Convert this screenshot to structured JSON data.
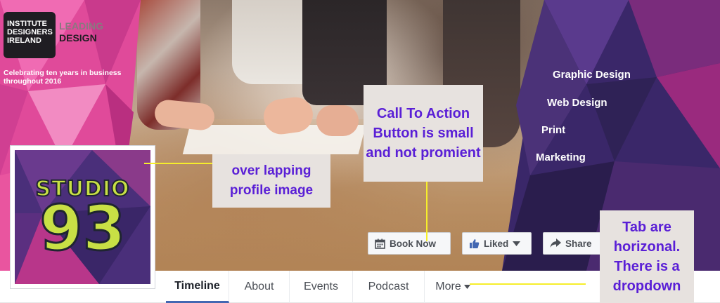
{
  "cover": {
    "logo_lines": [
      "INSTITUTE",
      "DESIGNERS",
      "IRELAND"
    ],
    "leading_lines": [
      "LEADING",
      "DESIGN"
    ],
    "celebration": "Celebrating ten years in business throughout 2016",
    "services": [
      "Graphic Design",
      "Web Design",
      "Print",
      "Marketing"
    ]
  },
  "profile": {
    "word": "STUDIO",
    "number": "93"
  },
  "actions": {
    "book_label": "Book Now",
    "liked_label": "Liked",
    "share_label": "Share"
  },
  "tabs": [
    {
      "label": "Timeline"
    },
    {
      "label": "About"
    },
    {
      "label": "Events"
    },
    {
      "label": "Podcast"
    },
    {
      "label": "More"
    }
  ],
  "annotations": {
    "profile_note": "over lapping profile image",
    "cta_note": "Call To Action Button is small and not promient",
    "tabs_note": "Tab are horizonal. There is a dropdown"
  },
  "colors": {
    "annotation_text": "#5a1fd6",
    "annotation_bg": "#e7e2df",
    "callout_line": "#f6ee2b",
    "active_tab_underline": "#4267b2",
    "like_blue": "#4267b2"
  }
}
